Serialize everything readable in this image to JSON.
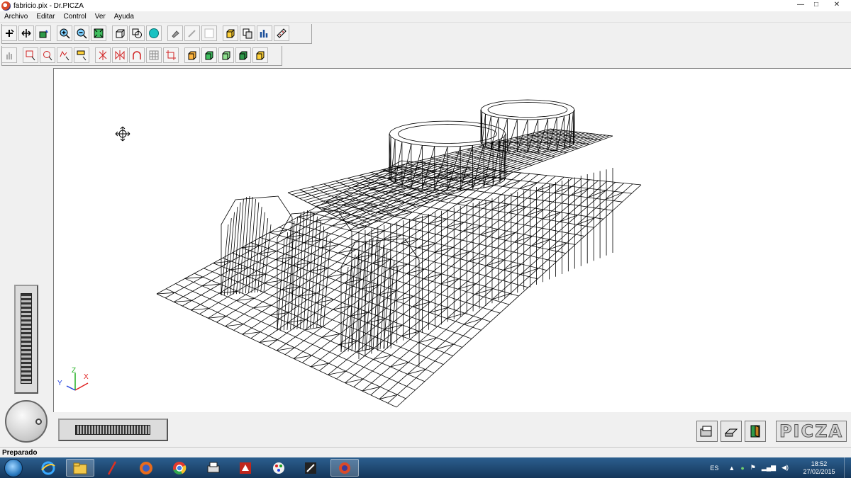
{
  "window": {
    "title": "fabricio.pix - Dr.PICZA",
    "minimize": "—",
    "maximize": "□",
    "close": "✕"
  },
  "menu": [
    "Archivo",
    "Editar",
    "Control",
    "Ver",
    "Ayuda"
  ],
  "toolbar_row1_icons": [
    "rotate-icon",
    "move-icon",
    "paint-bucket-icon",
    "zoom-in-icon",
    "zoom-out-icon",
    "zoom-fit-icon",
    "wireframe-cube-icon",
    "overlap-shapes-icon",
    "sphere-icon",
    "brush-icon",
    "pen-icon",
    "blank-box-icon",
    "cube-lines-icon",
    "copy-layers-icon",
    "bar-chart-icon",
    "ruler-icon"
  ],
  "toolbar_row2_icons": [
    "hand-icon",
    "select-rect-icon",
    "select-circle-icon",
    "select-freehand-icon",
    "select-text-icon",
    "mirror-vertical-icon",
    "mirror-horizontal-icon",
    "arch-icon",
    "grid-select-icon",
    "crop-icon",
    "view-front-icon",
    "view-top-icon",
    "view-side-icon",
    "view-iso-icon",
    "view-back-icon"
  ],
  "axes": {
    "x": "X",
    "y": "Y",
    "z": "Z"
  },
  "statusbar": {
    "text": "Preparado"
  },
  "bottom_buttons": [
    "scan-icon",
    "print-icon",
    "exit-door-icon"
  ],
  "logo": "PICZA",
  "taskbar": {
    "apps": [
      "explorer-icon",
      "ie-icon",
      "folder-icon",
      "pen-app-icon",
      "firefox-icon",
      "chrome-icon",
      "printer-app-icon",
      "pdf-icon",
      "paint-icon",
      "cnc-icon",
      "picza-icon"
    ],
    "lang": "ES",
    "time": "18:52",
    "date": "27/02/2015"
  }
}
